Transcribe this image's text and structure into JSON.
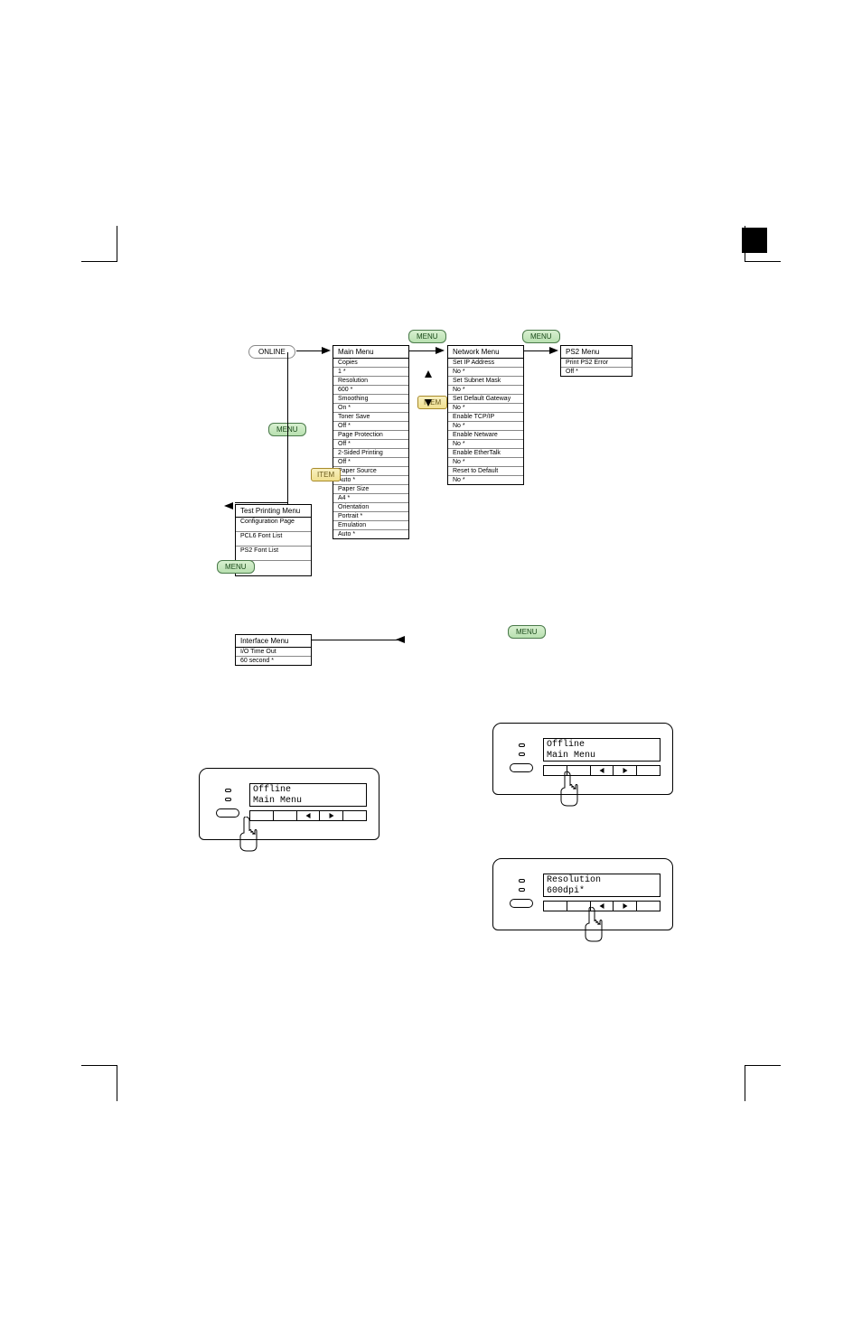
{
  "buttons": {
    "online": "ONLINE",
    "menu": "MENU",
    "item": "ITEM"
  },
  "mainMenu": {
    "title": "Main Menu",
    "items": [
      {
        "label": "Copies",
        "value": "1 *"
      },
      {
        "label": "Resolution",
        "value": "600 *"
      },
      {
        "label": "Smoothing",
        "value": "On *"
      },
      {
        "label": "Toner Save",
        "value": "Off *"
      },
      {
        "label": "Page Protection",
        "value": "Off *"
      },
      {
        "label": "2-Sided Printing",
        "value": "Off *"
      },
      {
        "label": "Paper Source",
        "value": "Auto *"
      },
      {
        "label": "Paper Size",
        "value": "A4 *"
      },
      {
        "label": "Orientation",
        "value": "Portrait *"
      },
      {
        "label": "Emulation",
        "value": "Auto *"
      }
    ]
  },
  "testMenu": {
    "title": "Test Printing Menu",
    "items": [
      "Configuration Page",
      "PCL6 Font List",
      "PS2 Font List",
      ""
    ]
  },
  "networkMenu": {
    "title": "Network Menu",
    "items": [
      {
        "label": "Set IP Address",
        "value": "No *"
      },
      {
        "label": "Set Subnet Mask",
        "value": "No *"
      },
      {
        "label": "Set Default Gateway",
        "value": "No *"
      },
      {
        "label": "Enable TCP/IP",
        "value": "No *"
      },
      {
        "label": "Enable Netware",
        "value": "No *"
      },
      {
        "label": "Enable EtherTalk",
        "value": "No *"
      },
      {
        "label": "Reset to Default",
        "value": "No *"
      }
    ]
  },
  "ps2Menu": {
    "title": "PS2 Menu",
    "items": [
      {
        "label": "Print PS2 Error",
        "value": "Off *"
      }
    ]
  },
  "interfaceMenu": {
    "title": "Interface Menu",
    "items": [
      {
        "label": "I/O Time Out",
        "value": "60 second *"
      }
    ]
  },
  "panels": [
    {
      "line1": "Offline",
      "line2": "Main Menu"
    },
    {
      "line1": "Offline",
      "line2": "Main Menu"
    },
    {
      "line1": "Resolution",
      "line2": "600dpi*"
    }
  ]
}
